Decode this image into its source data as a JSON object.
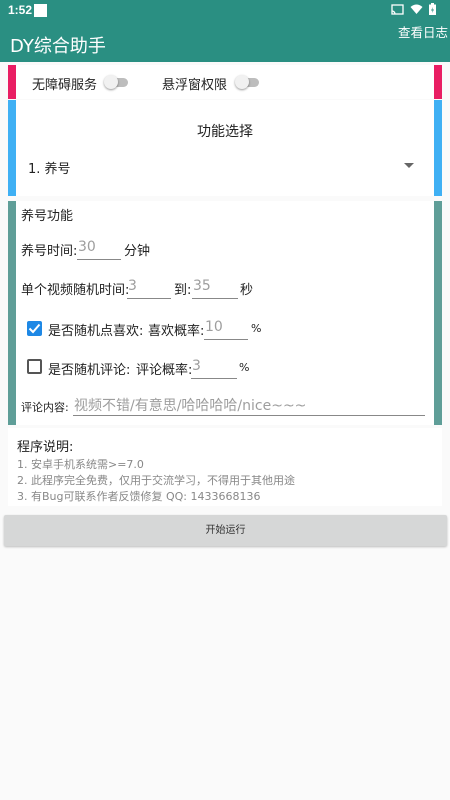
{
  "status_bar": {
    "time": "1:52"
  },
  "app_bar": {
    "title": "DY综合助手",
    "log_button": "查看日志"
  },
  "permissions": {
    "accessibility_label": "无障碍服务",
    "overlay_label": "悬浮窗权限",
    "accessibility_enabled": false,
    "overlay_enabled": false
  },
  "function_select": {
    "title": "功能选择",
    "selected": "1. 养号"
  },
  "yanghao": {
    "section_title": "养号功能",
    "duration_label": "养号时间:",
    "duration_value": "30",
    "duration_unit": "分钟",
    "random_time_label": "单个视频随机时间:",
    "random_min": "3",
    "random_to": "到:",
    "random_max": "35",
    "random_unit": "秒",
    "like_label": "是否随机点喜欢:",
    "like_checked": true,
    "like_prob_label": "喜欢概率:",
    "like_prob_value": "10",
    "like_prob_unit": "%",
    "comment_label": "是否随机评论:",
    "comment_checked": false,
    "comment_prob_label": "评论概率:",
    "comment_prob_value": "3",
    "comment_prob_unit": "%",
    "comment_content_label": "评论内容:",
    "comment_content_placeholder": "视频不错/有意思/哈哈哈哈/nice~~~"
  },
  "info": {
    "title": "程序说明:",
    "lines": [
      "1. 安卓手机系统需>=7.0",
      "2. 此程序完全免费，仅用于交流学习，不得用于其他用途",
      "3. 有Bug可联系作者反馈修复 QQ: 1433668136"
    ]
  },
  "start_button": "开始运行",
  "colors": {
    "app_bar": "#2a8f82",
    "accent_red": "#e91e63",
    "accent_blue": "#3fb0f4",
    "accent_teal": "#5f9e98",
    "checkbox_blue": "#1e88e5"
  }
}
